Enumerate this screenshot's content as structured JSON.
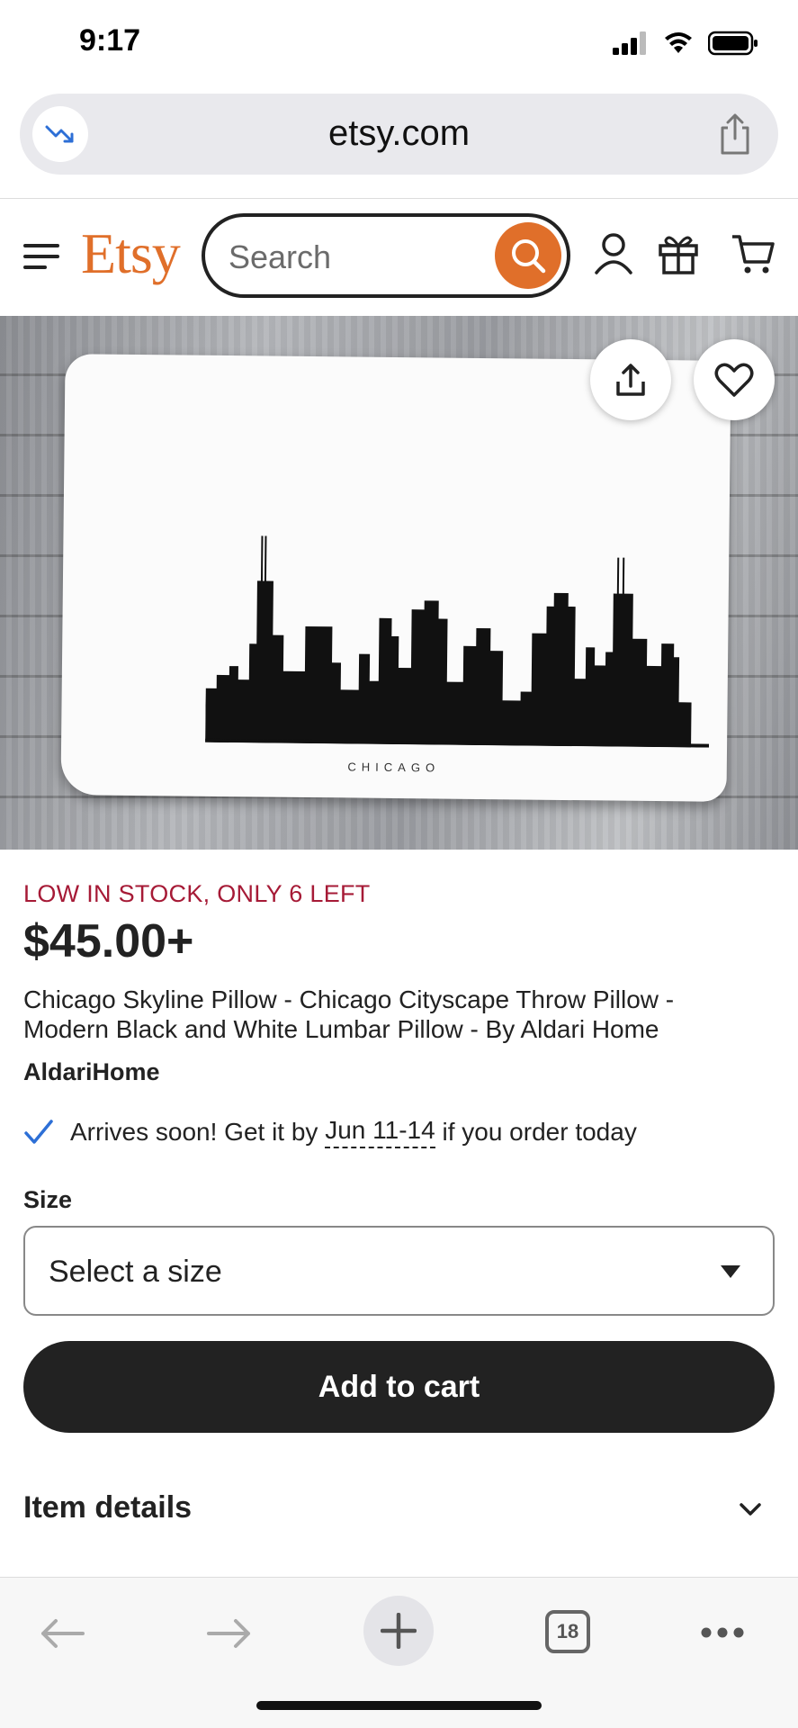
{
  "status_bar": {
    "time": "9:17"
  },
  "browser": {
    "url": "etsy.com"
  },
  "header": {
    "logo": "Etsy",
    "search_placeholder": "Search"
  },
  "hero": {
    "caption": "CHICAGO"
  },
  "product": {
    "stock_notice": "LOW IN STOCK, ONLY 6 LEFT",
    "price": "$45.00+",
    "title": "Chicago Skyline Pillow - Chicago Cityscape Throw Pillow - Modern Black and White Lumbar Pillow - By Aldari Home",
    "shop_name": "AldariHome",
    "arrives_prefix": "Arrives soon! Get it by",
    "arrives_date": "Jun 11-14",
    "arrives_suffix": "if you order today",
    "size_label": "Size",
    "size_select": "Select a size",
    "add_to_cart": "Add to cart",
    "item_details": "Item details"
  },
  "toolbar": {
    "tab_count": "18"
  },
  "colors": {
    "brand": "#e06f2a",
    "stock": "#a61a36",
    "button": "#222222"
  }
}
